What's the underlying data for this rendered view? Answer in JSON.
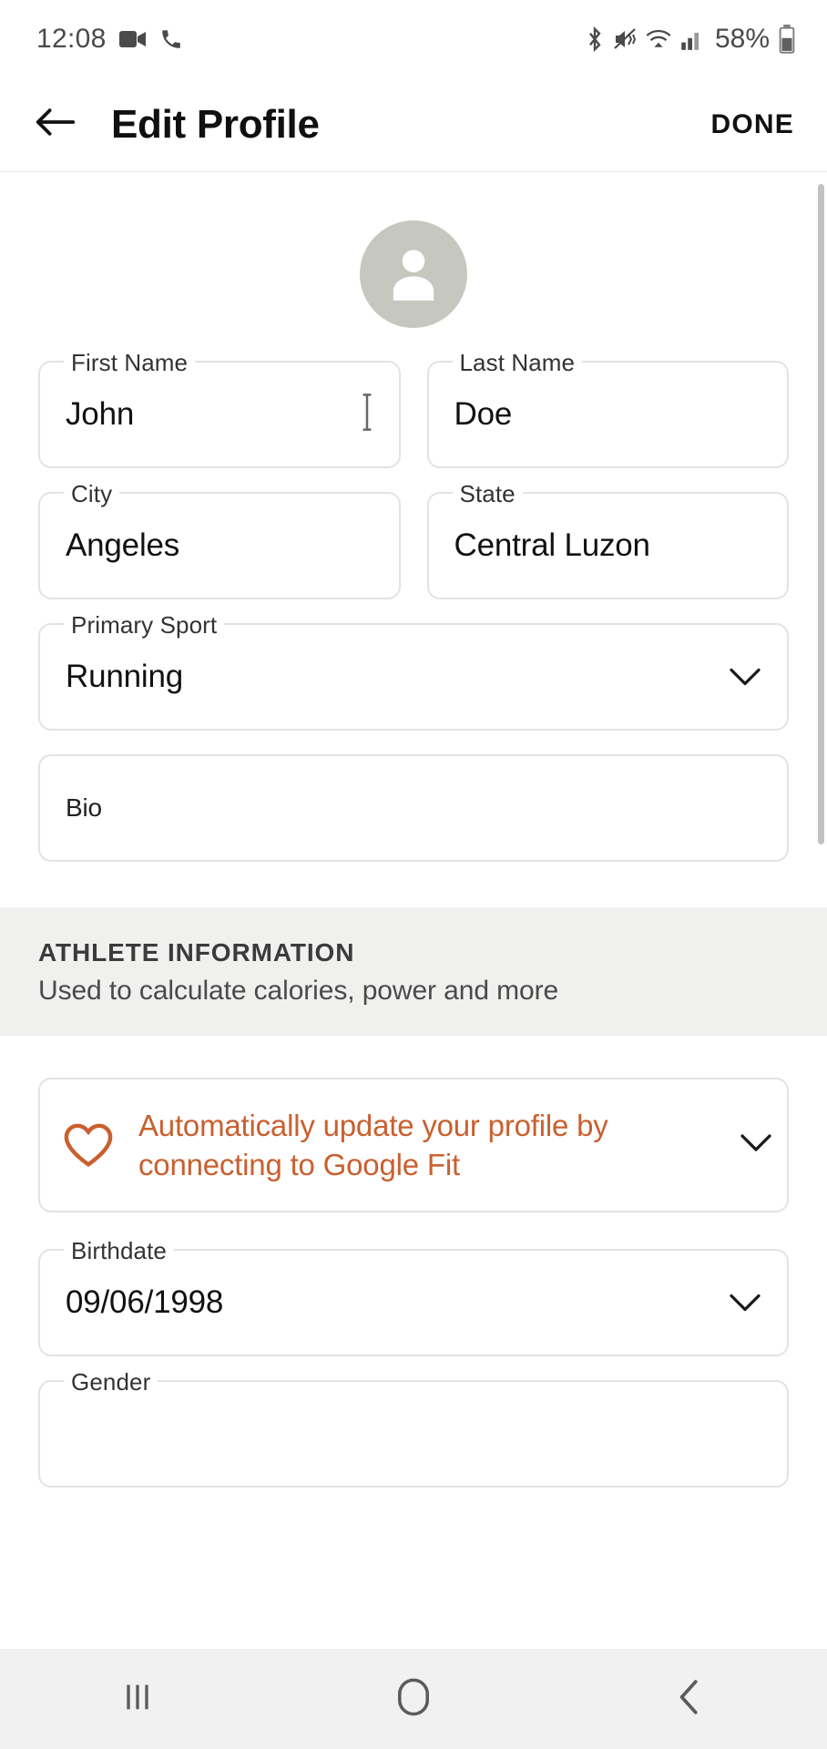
{
  "status_bar": {
    "time": "12:08",
    "battery_percent": "58%",
    "left_icons": [
      "video-camera-icon",
      "phone-call-icon"
    ],
    "right_icons": [
      "bluetooth-icon",
      "mute-vibrate-icon",
      "wifi-icon",
      "cellular-signal-icon",
      "battery-icon"
    ]
  },
  "header": {
    "back_icon": "arrow-left-icon",
    "title": "Edit Profile",
    "done_label": "DONE"
  },
  "profile": {
    "avatar_icon": "person-avatar-icon",
    "avatar_color": "#c6c8bf"
  },
  "form": {
    "first_name": {
      "label": "First Name",
      "value": "John"
    },
    "last_name": {
      "label": "Last Name",
      "value": "Doe"
    },
    "city": {
      "label": "City",
      "value": "Angeles"
    },
    "state": {
      "label": "State",
      "value": "Central Luzon"
    },
    "primary_sport": {
      "label": "Primary Sport",
      "value": "Running",
      "chevron": "chevron-down-icon"
    },
    "bio": {
      "placeholder": "Bio",
      "value": ""
    }
  },
  "athlete_section": {
    "title": "ATHLETE INFORMATION",
    "subtitle": "Used to calculate calories, power and more"
  },
  "google_fit_card": {
    "icon": "heart-outline-icon",
    "text": "Automatically update your profile by connecting to Google Fit",
    "chevron": "chevron-down-icon",
    "accent_color": "#c9602f"
  },
  "birthdate": {
    "label": "Birthdate",
    "value": "09/06/1998",
    "chevron": "chevron-down-icon"
  },
  "gender": {
    "label": "Gender",
    "value": ""
  },
  "nav_bar": {
    "recents_icon": "recents-icon",
    "home_icon": "home-icon",
    "back_icon": "back-chevron-icon"
  },
  "colors": {
    "accent": "#c9602f",
    "section_background": "#f0f0ef",
    "border": "#e3e3e3",
    "nav_background": "#f1f1f1"
  }
}
